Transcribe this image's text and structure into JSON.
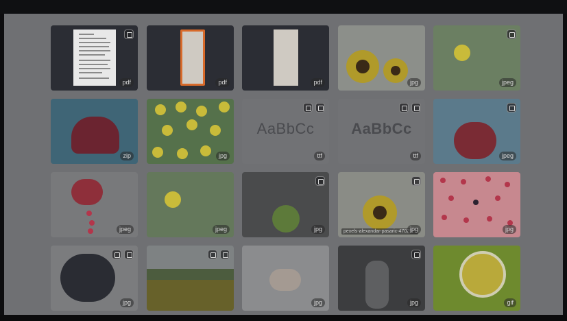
{
  "tiles": [
    {
      "ext": "pdf"
    },
    {
      "ext": "pdf"
    },
    {
      "ext": "pdf"
    },
    {
      "ext": "jpg"
    },
    {
      "ext": "jpeg"
    },
    {
      "ext": "zip"
    },
    {
      "ext": "jpg"
    },
    {
      "ext": "ttf",
      "sample": "AaBbCc"
    },
    {
      "ext": "ttf",
      "sample": "AaBbCc"
    },
    {
      "ext": "jpeg"
    },
    {
      "ext": "jpeg"
    },
    {
      "ext": "jpeg"
    },
    {
      "ext": "jpg"
    },
    {
      "ext": "jpg",
      "filename": "pexels-alexandar-pasaric-47025..."
    },
    {
      "ext": "jpg"
    },
    {
      "ext": "jpg"
    },
    {
      "ext": "jpg"
    },
    {
      "ext": "jpg"
    },
    {
      "ext": "jpg"
    },
    {
      "ext": "gif"
    }
  ],
  "doc_labels": {
    "true_logo": "true"
  },
  "colors": {
    "overlay": "#6f7073",
    "tile_dark": "#2b2d34",
    "lemon": "#c9bb3a",
    "pink": "#c7888f"
  }
}
